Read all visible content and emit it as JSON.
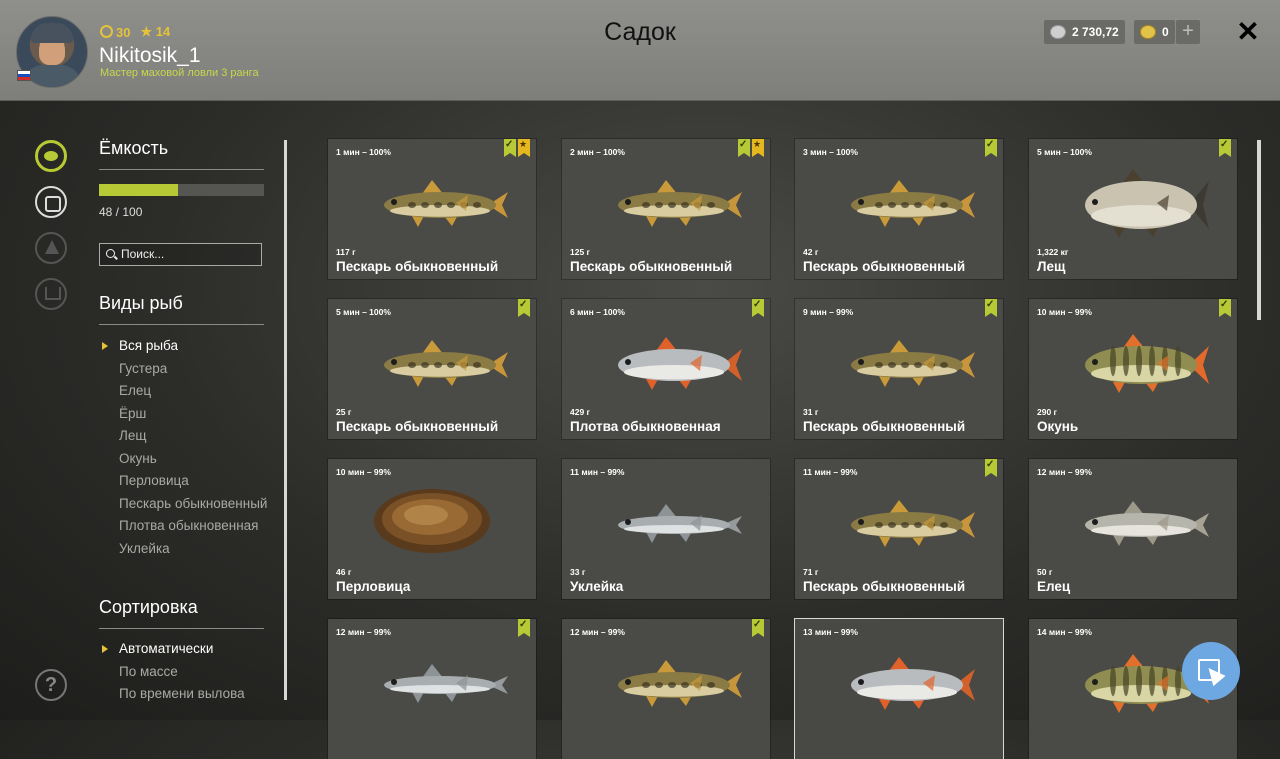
{
  "header": {
    "title": "Садок",
    "player": {
      "level": "30",
      "stars": "14",
      "username": "Nikitosik_1",
      "rank": "Мастер маховой ловли 3 ранга"
    },
    "silver": "2 730,72",
    "gold": "0",
    "plus": "+",
    "close": "✕"
  },
  "sidebar": {
    "capacity_title": "Ёмкость",
    "capacity_text": "48 / 100",
    "capacity_fraction": 0.48,
    "search_placeholder": "Поиск...",
    "species_title": "Виды рыб",
    "species": [
      "Вся рыба",
      "Густера",
      "Елец",
      "Ёрш",
      "Лещ",
      "Окунь",
      "Перловица",
      "Пескарь обыкновенный",
      "Плотва обыкновенная",
      "Уклейка"
    ],
    "species_active": 0,
    "sort_title": "Сортировка",
    "sort_options": [
      "Автоматически",
      "По массе",
      "По времени вылова"
    ],
    "sort_active": 0,
    "help": "?"
  },
  "colors": {
    "accent": "#b7c934",
    "gold": "#e5c23a",
    "fab": "#6ea8e3"
  },
  "fish": [
    {
      "time": "1 мин – 100%",
      "weight": "117 г",
      "name": "Пескарь обыкновенный",
      "kind": "gudgeon",
      "badges": [
        "check",
        "star"
      ]
    },
    {
      "time": "2 мин – 100%",
      "weight": "125 г",
      "name": "Пескарь обыкновенный",
      "kind": "gudgeon",
      "badges": [
        "check",
        "star"
      ]
    },
    {
      "time": "3 мин – 100%",
      "weight": "42 г",
      "name": "Пескарь обыкновенный",
      "kind": "gudgeon",
      "badges": [
        "check"
      ]
    },
    {
      "time": "5 мин – 100%",
      "weight": "1,322 кг",
      "name": "Лещ",
      "kind": "bream",
      "badges": [
        "check"
      ]
    },
    {
      "time": "5 мин – 100%",
      "weight": "25 г",
      "name": "Пескарь обыкновенный",
      "kind": "gudgeon",
      "badges": [
        "check"
      ]
    },
    {
      "time": "6 мин – 100%",
      "weight": "429 г",
      "name": "Плотва обыкновенная",
      "kind": "roach",
      "badges": [
        "check"
      ]
    },
    {
      "time": "9 мин – 99%",
      "weight": "31 г",
      "name": "Пескарь обыкновенный",
      "kind": "gudgeon",
      "badges": [
        "check"
      ]
    },
    {
      "time": "10 мин – 99%",
      "weight": "290 г",
      "name": "Окунь",
      "kind": "perch",
      "badges": [
        "check"
      ]
    },
    {
      "time": "10 мин – 99%",
      "weight": "46 г",
      "name": "Перловица",
      "kind": "mussel",
      "badges": []
    },
    {
      "time": "11 мин – 99%",
      "weight": "33 г",
      "name": "Уклейка",
      "kind": "bleak",
      "badges": []
    },
    {
      "time": "11 мин – 99%",
      "weight": "71 г",
      "name": "Пескарь обыкновенный",
      "kind": "gudgeon",
      "badges": [
        "check"
      ]
    },
    {
      "time": "12 мин – 99%",
      "weight": "50 г",
      "name": "Елец",
      "kind": "dace",
      "badges": []
    },
    {
      "time": "12 мин – 99%",
      "weight": "",
      "name": "",
      "kind": "bleak",
      "badges": [
        "check"
      ]
    },
    {
      "time": "12 мин – 99%",
      "weight": "",
      "name": "",
      "kind": "gudgeon",
      "badges": [
        "check"
      ]
    },
    {
      "time": "13 мин – 99%",
      "weight": "",
      "name": "",
      "kind": "roach",
      "badges": [],
      "selected": true
    },
    {
      "time": "14 мин – 99%",
      "weight": "",
      "name": "",
      "kind": "perch",
      "badges": []
    }
  ]
}
